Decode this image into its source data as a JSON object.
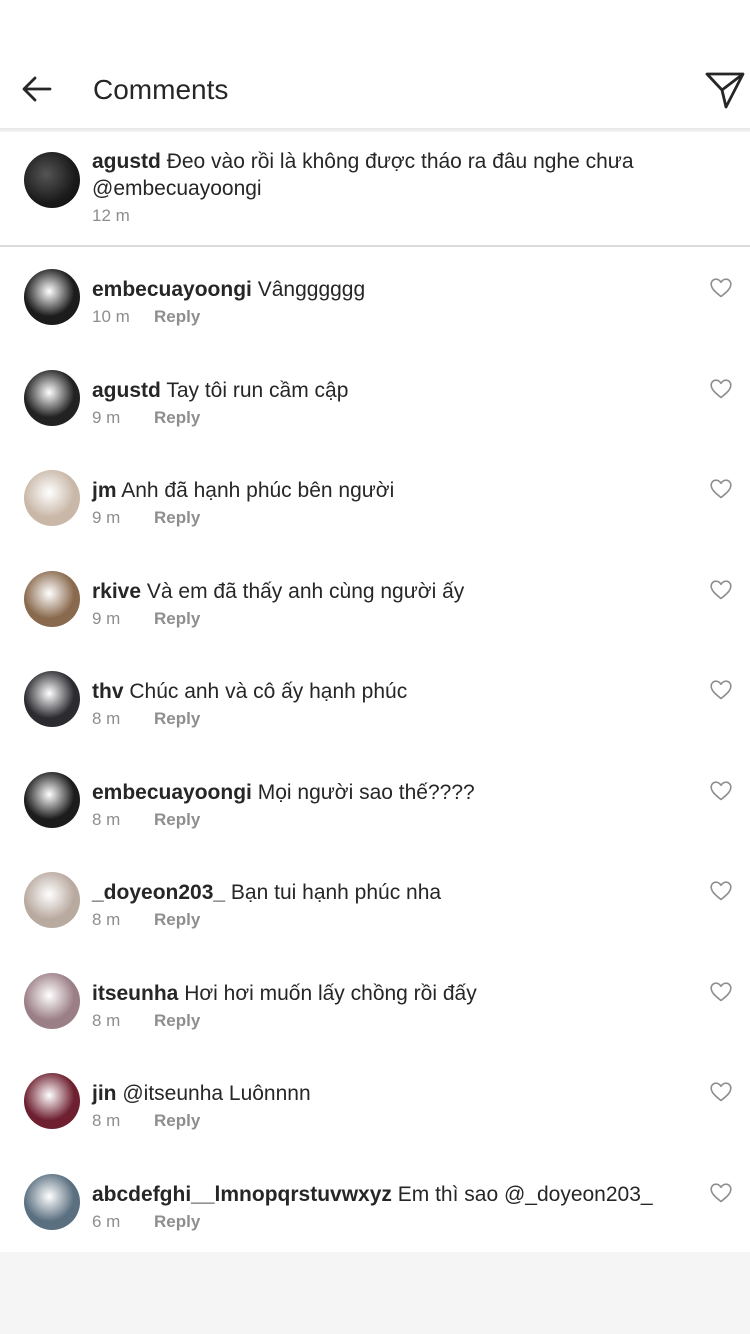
{
  "header": {
    "title": "Comments",
    "back_icon": "arrow-left-icon",
    "send_icon": "paper-plane-icon"
  },
  "caption": {
    "username": "agustd",
    "text": "Đeo vào rồi là không được tháo ra đâu nghe chưa @embecuayoongi",
    "time": "12 m"
  },
  "comments": [
    {
      "username": "embecuayoongi",
      "text": "Vângggggg",
      "time": "10 m",
      "reply": "Reply",
      "avatar_color": "#1c1c1c"
    },
    {
      "username": "agustd",
      "text": "Tay tôi run cầm cập",
      "time": "9 m",
      "reply": "Reply",
      "avatar_color": "#222222"
    },
    {
      "username": "jm",
      "text": "Anh đã hạnh phúc bên người",
      "time": "9 m",
      "reply": "Reply",
      "avatar_color": "#c9b8a8"
    },
    {
      "username": "rkive",
      "text": "Và em đã thấy anh cùng người ấy",
      "time": "9 m",
      "reply": "Reply",
      "avatar_color": "#8a6a4e"
    },
    {
      "username": "thv",
      "text": "Chúc anh và cô ấy hạnh phúc",
      "time": "8 m",
      "reply": "Reply",
      "avatar_color": "#2b2b30"
    },
    {
      "username": "embecuayoongi",
      "text": "Mọi người sao thế????",
      "time": "8 m",
      "reply": "Reply",
      "avatar_color": "#1c1c1c"
    },
    {
      "username": "_doyeon203_",
      "text": "Bạn tui hạnh phúc nha",
      "time": "8 m",
      "reply": "Reply",
      "avatar_color": "#b9aaa0"
    },
    {
      "username": "itseunha",
      "text": "Hơi hơi muốn lấy chồng rồi đấy",
      "time": "8 m",
      "reply": "Reply",
      "avatar_color": "#9b7f86"
    },
    {
      "username": "jin",
      "text": "@itseunha Luônnnn",
      "time": "8 m",
      "reply": "Reply",
      "avatar_color": "#6e2030"
    },
    {
      "username": "abcdefghi__lmnopqrstuvwxyz",
      "text": "Em thì sao @_doyeon203_",
      "time": "6 m",
      "reply": "Reply",
      "avatar_color": "#5a6f80"
    }
  ],
  "colors": {
    "text": "#262626",
    "secondary": "#8e8e8e",
    "divider": "#dbdbdb"
  }
}
